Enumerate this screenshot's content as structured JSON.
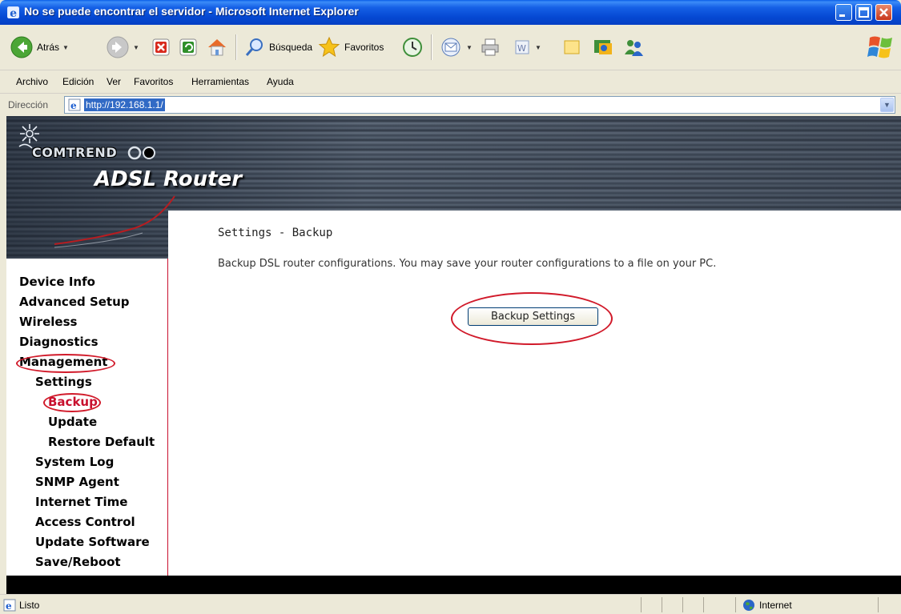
{
  "window": {
    "title": "No se puede encontrar el servidor - Microsoft Internet Explorer"
  },
  "toolbar": {
    "back_label": "Atrás",
    "search_label": "Búsqueda",
    "favorites_label": "Favoritos"
  },
  "menu": [
    "Archivo",
    "Edición",
    "Ver",
    "Favoritos",
    "Herramientas",
    "Ayuda"
  ],
  "address": {
    "label": "Dirección",
    "url": "http://192.168.1.1/"
  },
  "banner": {
    "brand": "COMTREND",
    "product": "ADSL Router"
  },
  "sidebar": {
    "items": [
      {
        "label": "Device Info"
      },
      {
        "label": "Advanced Setup"
      },
      {
        "label": "Wireless"
      },
      {
        "label": "Diagnostics"
      },
      {
        "label": "Management"
      },
      {
        "label": "Settings"
      },
      {
        "label": "Backup"
      },
      {
        "label": "Update"
      },
      {
        "label": "Restore Default"
      },
      {
        "label": "System Log"
      },
      {
        "label": "SNMP Agent"
      },
      {
        "label": "Internet Time"
      },
      {
        "label": "Access Control"
      },
      {
        "label": "Update Software"
      },
      {
        "label": "Save/Reboot"
      }
    ]
  },
  "main": {
    "title": "Settings - Backup",
    "description": "Backup DSL router configurations. You may save your router configurations to a file on your PC.",
    "button_label": "Backup Settings"
  },
  "status": {
    "text": "Listo",
    "zone": "Internet"
  },
  "colors": {
    "titlebar": "#0548d2",
    "highlight_ring": "#d11a2a",
    "sidebar_border": "#c8102e"
  }
}
